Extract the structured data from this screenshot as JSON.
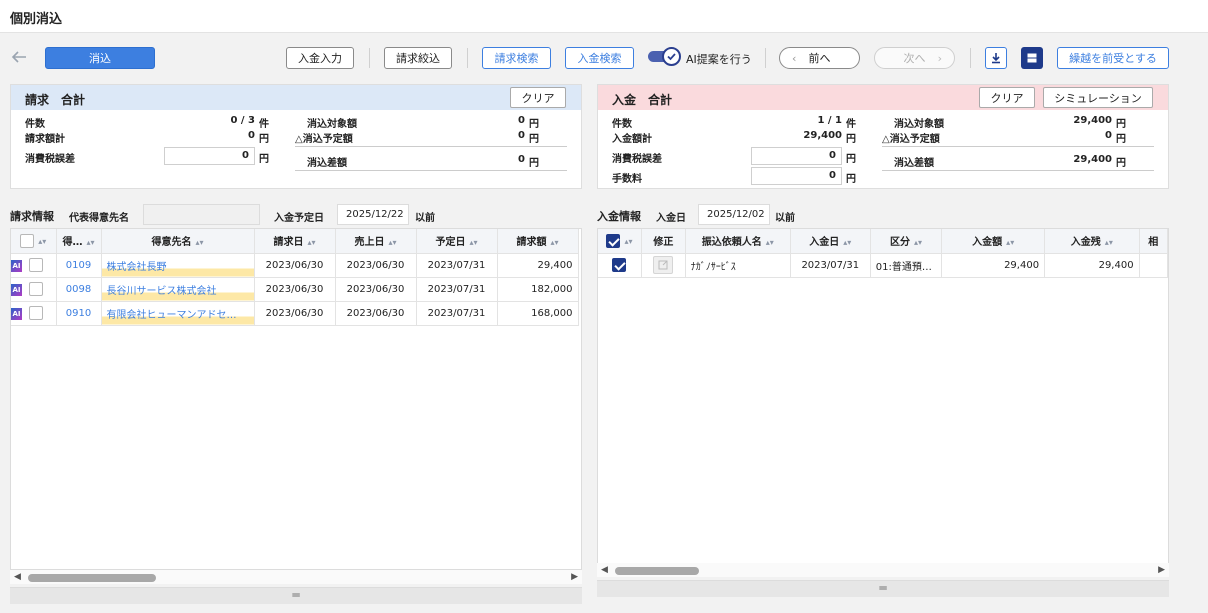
{
  "title": "個別消込",
  "toolbar": {
    "keshikomi": "消込",
    "nyukin_input": "入金入力",
    "seikyu_filter": "請求絞込",
    "seikyu_search": "請求検索",
    "nyukin_search": "入金検索",
    "ai_toggle_label": "AI提案を行う",
    "prev": "前へ",
    "next": "次へ",
    "carryover": "繰越を前受とする"
  },
  "seikyu_summary": {
    "header": "請求　合計",
    "clear": "クリア",
    "count_label": "件数",
    "count_value": "0 / 3",
    "count_unit": "件",
    "total_label": "請求額計",
    "total_value": "0",
    "yen": "円",
    "tax_label": "消費税誤差",
    "tax_value": "0",
    "target_label": "消込対象額",
    "target_value": "0",
    "planned_label": "△消込予定額",
    "planned_value": "0",
    "diff_label": "消込差額",
    "diff_value": "0"
  },
  "nyukin_summary": {
    "header": "入金　合計",
    "clear": "クリア",
    "simulation": "シミュレーション",
    "count_label": "件数",
    "count_value": "1 / 1",
    "count_unit": "件",
    "total_label": "入金額計",
    "total_value": "29,400",
    "yen": "円",
    "tax_label": "消費税誤差",
    "tax_value": "0",
    "fee_label": "手数料",
    "fee_value": "0",
    "target_label": "消込対象額",
    "target_value": "29,400",
    "planned_label": "△消込予定額",
    "planned_value": "0",
    "diff_label": "消込差額",
    "diff_value": "29,400"
  },
  "seikyu_info": {
    "label": "請求情報",
    "rep_label": "代表得意先名",
    "rep_value": "",
    "date_label": "入金予定日",
    "date_value": "2025/12/22",
    "date_suffix": "以前",
    "columns": [
      "得…",
      "得意先名",
      "請求日",
      "売上日",
      "予定日",
      "請求額"
    ],
    "rows": [
      {
        "ai": "AI",
        "code": "0109",
        "name": "株式会社長野",
        "billing_date": "2023/06/30",
        "sales_date": "2023/06/30",
        "due_date": "2023/07/31",
        "amount": "29,400"
      },
      {
        "ai": "AI",
        "code": "0098",
        "name": "長谷川サービス株式会社",
        "billing_date": "2023/06/30",
        "sales_date": "2023/06/30",
        "due_date": "2023/07/31",
        "amount": "182,000"
      },
      {
        "ai": "AI",
        "code": "0910",
        "name": "有限会社ヒューマンアドセ…",
        "billing_date": "2023/06/30",
        "sales_date": "2023/06/30",
        "due_date": "2023/07/31",
        "amount": "168,000"
      }
    ]
  },
  "nyukin_info": {
    "label": "入金情報",
    "date_label": "入金日",
    "date_value": "2025/12/02",
    "date_suffix": "以前",
    "columns": [
      "修正",
      "振込依頼人名",
      "入金日",
      "区分",
      "入金額",
      "入金残",
      "相"
    ],
    "rows": [
      {
        "payer": "ﾅｶﾞﾉｻｰﾋﾞｽ",
        "date": "2023/07/31",
        "category": "01:普通預…",
        "amount": "29,400",
        "balance": "29,400"
      }
    ]
  },
  "colors": {
    "primary": "#3d7fe0",
    "seikyu_header": "#dce8f7",
    "nyukin_header": "#fadadd",
    "dark_navy": "#1e3a8a"
  }
}
